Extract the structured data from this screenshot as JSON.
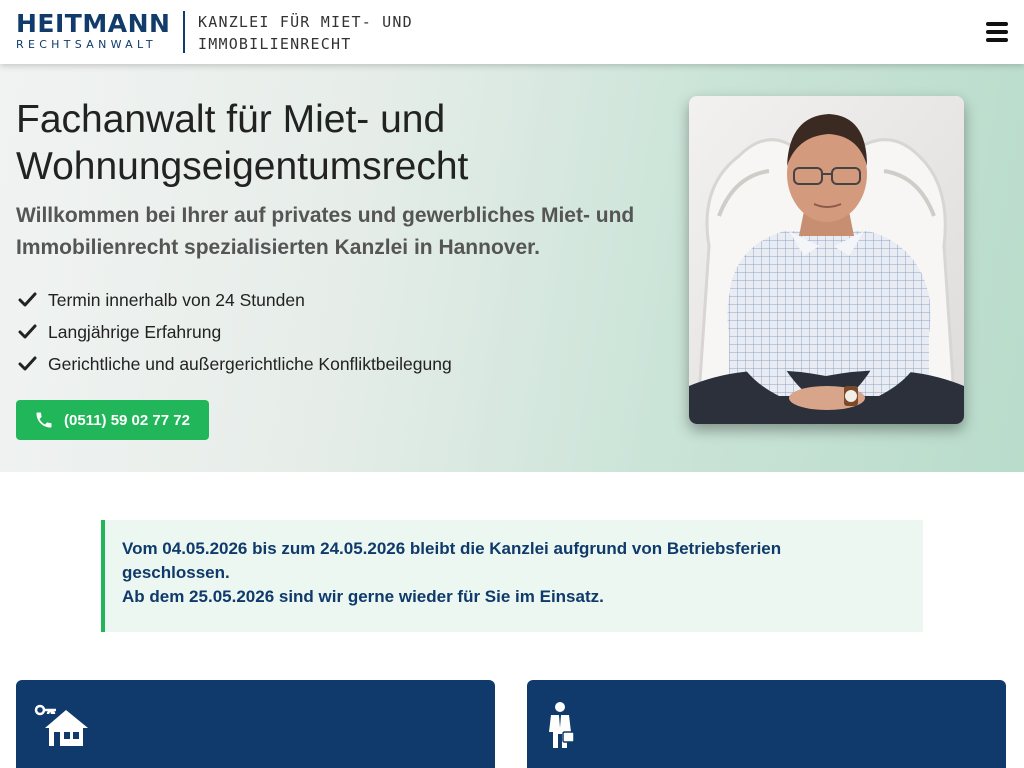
{
  "header": {
    "logo_name": "HEITMANN",
    "logo_sub": "RECHTSANWALT",
    "tagline_line1": "KANZLEI FÜR MIET- UND",
    "tagline_line2": "IMMOBILIENRECHT",
    "menu_icon": "hamburger-menu-icon"
  },
  "hero": {
    "title_line1": "Fachanwalt für Miet- und",
    "title_line2": "Wohnungseigentumsrecht",
    "subtitle_line1": "Willkommen bei Ihrer auf privates und gewerbliches Miet- und",
    "subtitle_line2": "Immobilienrecht spezialisierten Kanzlei in Hannover.",
    "checklist": [
      "Termin innerhalb von 24 Stunden",
      "Langjährige Erfahrung",
      "Gerichtliche und außergerichtliche Konfliktbeilegung"
    ],
    "call_button": "(0511) 59 02 77 72",
    "colors": {
      "accent_green": "#22b65a",
      "brand_navy": "#0f3a6b"
    }
  },
  "notice": {
    "line1": "Vom 04.05.2026 bis zum 24.05.2026 bleibt die Kanzlei aufgrund von Betriebsferien",
    "line2": "geschlossen.",
    "line3": "Ab dem 25.05.2026 sind wir gerne wieder für Sie im Einsatz."
  },
  "cards": [
    {
      "icon": "house-with-keys-icon"
    },
    {
      "icon": "lawyer-with-briefcase-icon"
    }
  ]
}
